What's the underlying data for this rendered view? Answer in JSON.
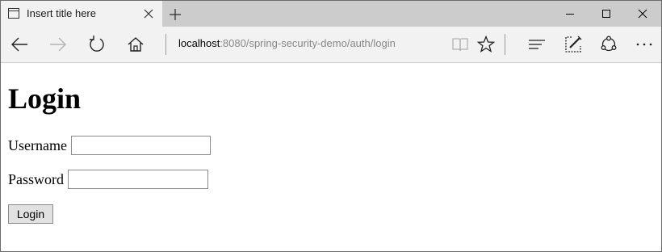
{
  "browser": {
    "tab": {
      "title": "Insert title here"
    },
    "address": {
      "host": "localhost",
      "path": ":8080/spring-security-demo/auth/login"
    },
    "icons": {
      "page": "page-icon",
      "close_tab": "close-icon",
      "new_tab": "plus-icon",
      "back": "arrow-left-icon",
      "forward": "arrow-right-icon",
      "refresh": "refresh-icon",
      "home": "home-icon",
      "reading_view": "book-icon",
      "favorites": "star-icon",
      "hub": "hub-lines-icon",
      "web_note": "pen-note-icon",
      "share": "share-icon",
      "more": "more-dots-icon"
    }
  },
  "page": {
    "heading": "Login",
    "username_label": "Username",
    "username_value": "",
    "password_label": "Password",
    "password_value": "",
    "submit_label": "Login"
  }
}
